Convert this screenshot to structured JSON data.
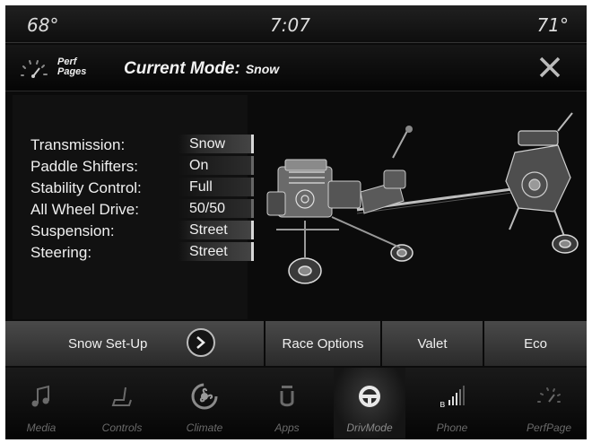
{
  "status_bar": {
    "temp_left": "68°",
    "time": "7:07",
    "temp_right": "71°"
  },
  "header": {
    "perf_pages_line1": "Perf",
    "perf_pages_line2": "Pages",
    "mode_label": "Current Mode:",
    "mode_value": "Snow",
    "close_icon": "close-icon"
  },
  "settings": [
    {
      "label": "Transmission:",
      "value": "Snow"
    },
    {
      "label": "Paddle Shifters:",
      "value": "On"
    },
    {
      "label": "Stability Control:",
      "value": "Full"
    },
    {
      "label": "All Wheel Drive:",
      "value": "50/50"
    },
    {
      "label": "Suspension:",
      "value": "Street"
    },
    {
      "label": "Steering:",
      "value": "Street"
    }
  ],
  "buttons": {
    "snow_setup": "Snow Set-Up",
    "race_options": "Race Options",
    "valet": "Valet",
    "eco": "Eco"
  },
  "nav": {
    "items": [
      {
        "label": "Media",
        "icon": "music-note-icon"
      },
      {
        "label": "Controls",
        "icon": "seat-icon"
      },
      {
        "label": "Climate",
        "icon": "fan-icon"
      },
      {
        "label": "Apps",
        "icon": "apps-icon"
      },
      {
        "label": "DrivMode",
        "icon": "steering-wheel-icon"
      },
      {
        "label": "Phone",
        "icon": "phone-signal-icon"
      },
      {
        "label": "PerfPage",
        "icon": "gauge-icon"
      }
    ],
    "active": "DrivMode"
  },
  "colors": {
    "background": "#0b0b0b",
    "text": "#f0f0f0",
    "inactive_nav": "#6a6a6a"
  }
}
